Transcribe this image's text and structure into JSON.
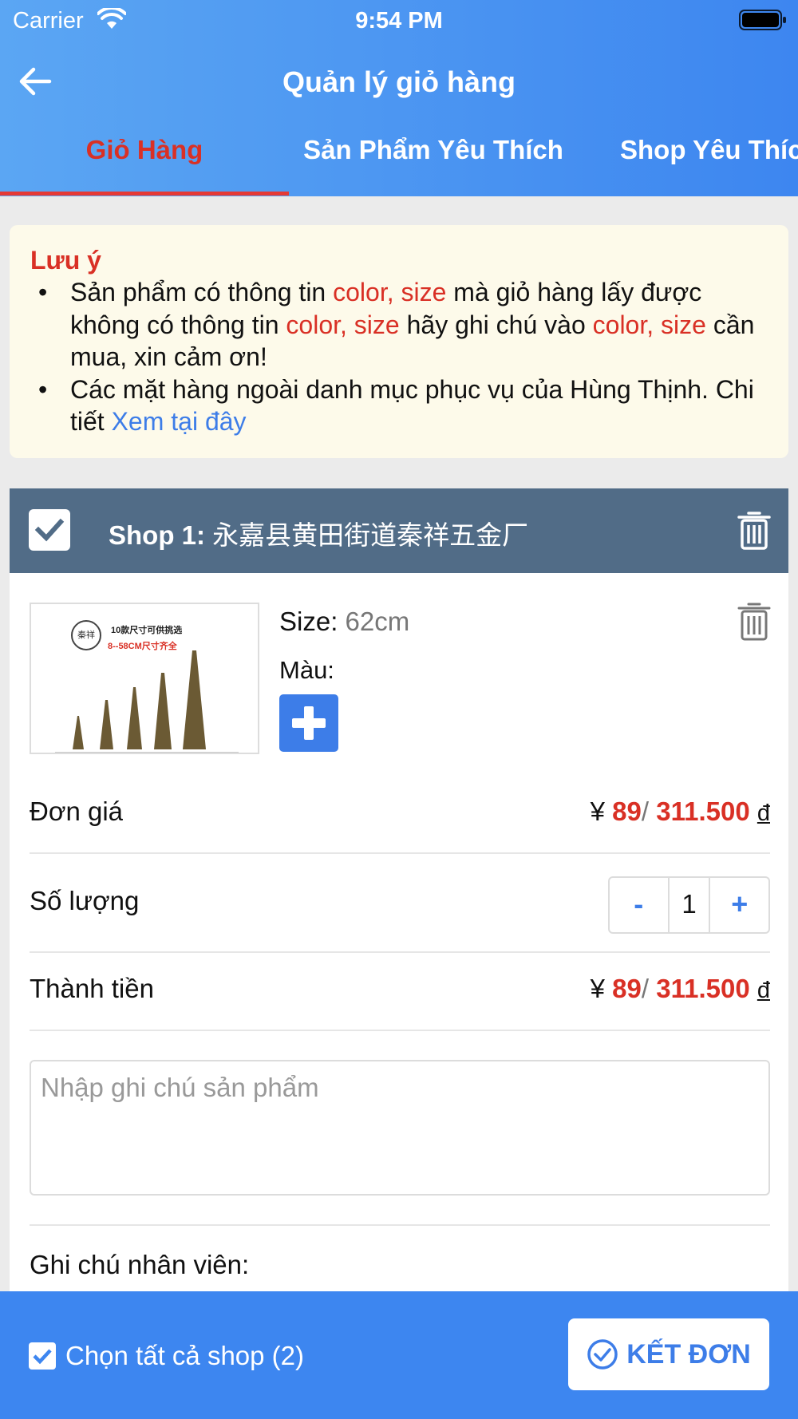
{
  "status_bar": {
    "carrier": "Carrier",
    "time": "9:54 PM"
  },
  "header": {
    "title": "Quản lý giỏ hàng"
  },
  "tabs": [
    {
      "label": "Giỏ Hàng",
      "active": true
    },
    {
      "label": "Sản Phẩm Yêu Thích",
      "active": false
    },
    {
      "label": "Shop Yêu Thích",
      "active": false
    }
  ],
  "notice": {
    "title": "Lưu ý",
    "line1_a": "Sản phẩm có thông tin ",
    "line1_red1": "color, size",
    "line1_b": " mà giỏ hàng lấy được không có thông tin ",
    "line1_red2": "color, size",
    "line1_c": " hãy ghi chú vào ",
    "line1_red3": "color, size",
    "line1_d": " cần mua, xin cảm ơn!",
    "line2_a": " Các mặt hàng ngoài danh mục phục vụ của Hùng Thịnh. Chi tiết ",
    "line2_link": "Xem tại đây"
  },
  "shop": {
    "prefix": "Shop 1:",
    "name": "永嘉县黄田街道秦祥五金厂",
    "checked": true
  },
  "item": {
    "image_title": "10款尺寸可供挑选",
    "image_subtitle": "8--58CM尺寸齐全",
    "image_logo": "秦祥",
    "size_label": "Size:",
    "size_value": "62cm",
    "color_label": "Màu:",
    "unit_price_label": "Đơn giá",
    "unit_price_yen_symbol": "¥",
    "unit_price_yen": "89",
    "unit_price_vnd": "311.500",
    "currency_vnd": "đ",
    "quantity_label": "Số lượng",
    "quantity_minus": "-",
    "quantity": "1",
    "quantity_plus": "+",
    "total_label": "Thành tiền",
    "total_yen": "89",
    "total_vnd": "311.500",
    "note_placeholder": "Nhập ghi chú sản phẩm",
    "staff_note_label": "Ghi chú nhân viên:"
  },
  "bottom_bar": {
    "select_all_label": "Chọn tất cả shop (2)",
    "select_all_checked": true,
    "checkout_label": "KẾT ĐƠN"
  },
  "colors": {
    "header_blue": "#3d86f0",
    "active_red": "#d93025",
    "shop_header": "#516c87",
    "notice_bg": "#fdfaea"
  }
}
